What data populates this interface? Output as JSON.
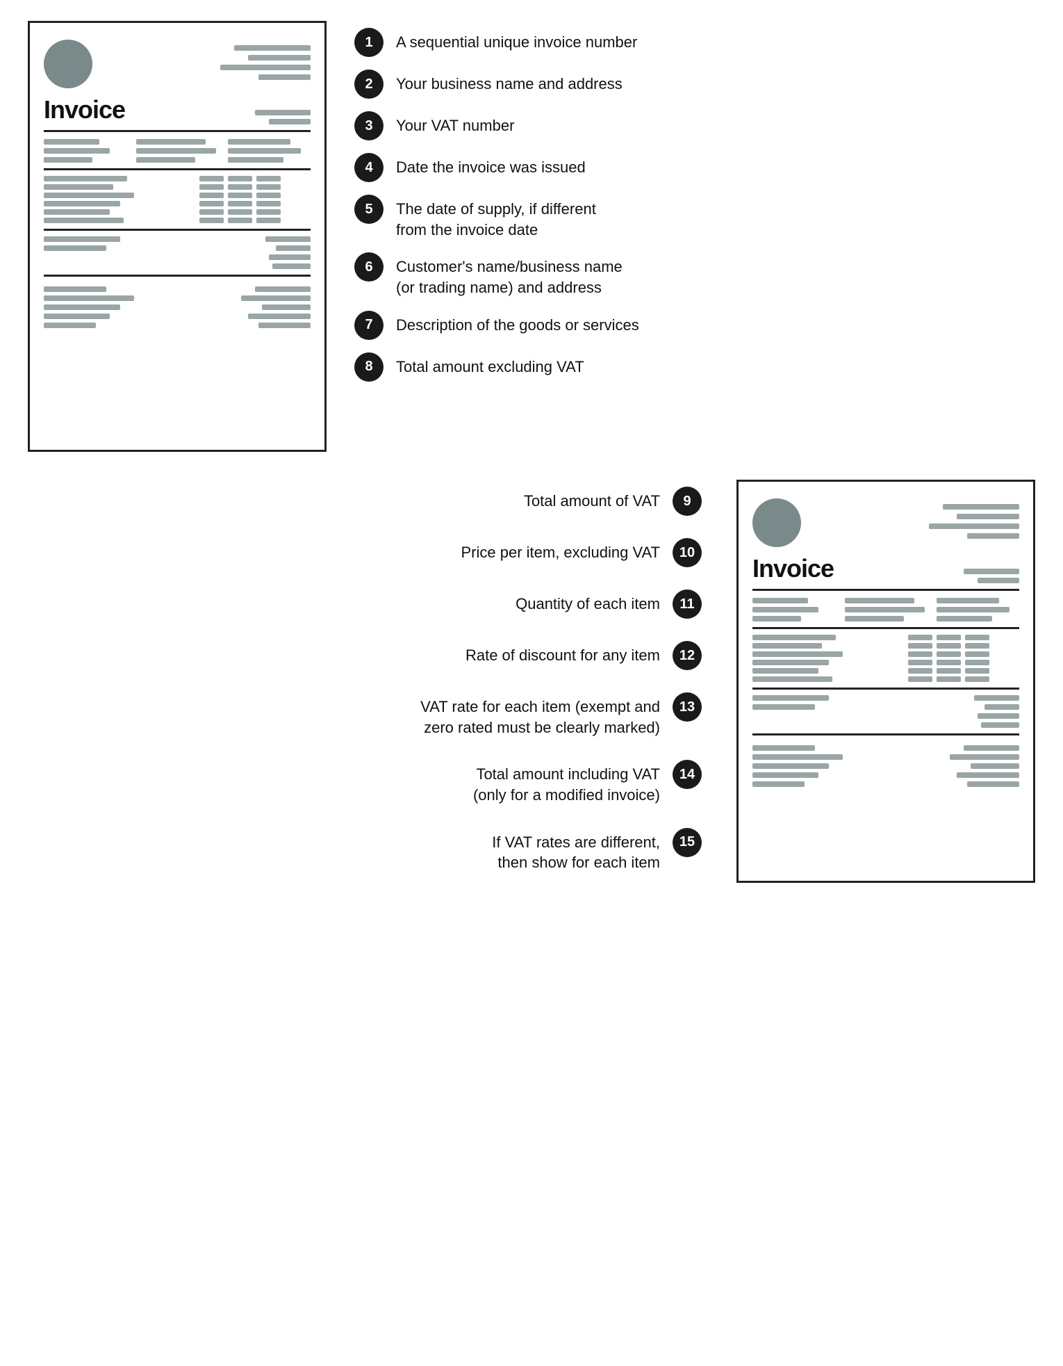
{
  "top": {
    "invoice_title": "Invoice",
    "items": [
      {
        "number": "1",
        "text": "A sequential unique invoice number"
      },
      {
        "number": "2",
        "text": "Your business name and address"
      },
      {
        "number": "3",
        "text": "Your VAT number"
      },
      {
        "number": "4",
        "text": "Date the invoice was issued"
      },
      {
        "number": "5",
        "text": "The date of supply, if different\nfrom the invoice date"
      },
      {
        "number": "6",
        "text": "Customer's name/business name\n(or trading name) and address"
      },
      {
        "number": "7",
        "text": "Description of the goods or services"
      },
      {
        "number": "8",
        "text": "Total amount excluding VAT"
      }
    ]
  },
  "bottom": {
    "invoice_title": "Invoice",
    "items": [
      {
        "number": "9",
        "text": "Total amount of VAT"
      },
      {
        "number": "10",
        "text": "Price per item, excluding VAT"
      },
      {
        "number": "11",
        "text": "Quantity of each item"
      },
      {
        "number": "12",
        "text": "Rate of discount for any item"
      },
      {
        "number": "13",
        "text": "VAT rate for each item (exempt and\nzero rated must be clearly marked)"
      },
      {
        "number": "14",
        "text": "Total amount including VAT\n(only for a modified invoice)"
      },
      {
        "number": "15",
        "text": "If VAT rates are different,\nthen show for each item"
      }
    ]
  }
}
